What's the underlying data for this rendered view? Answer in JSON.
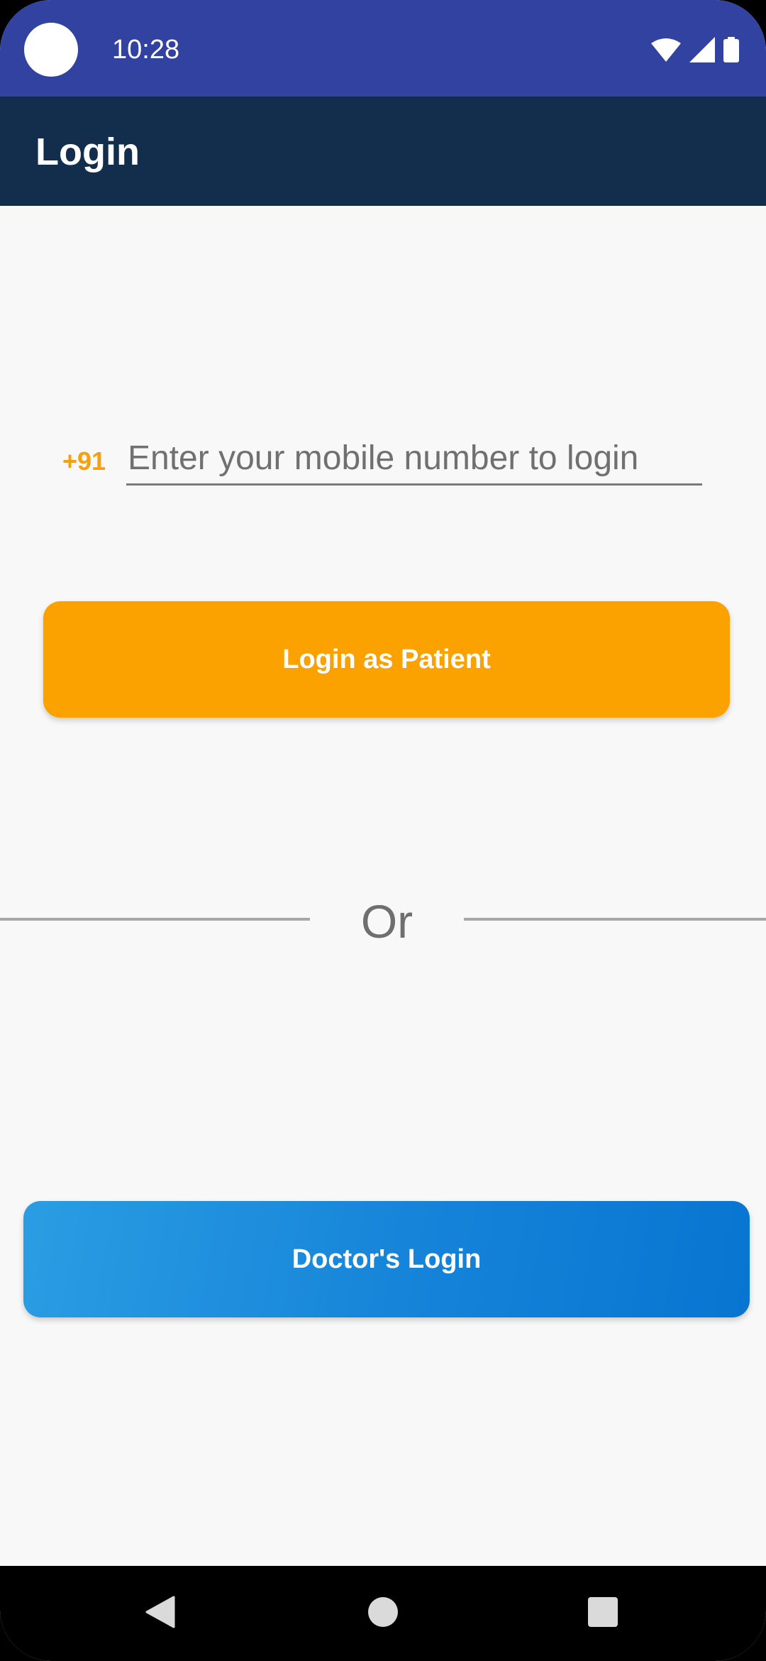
{
  "status_bar": {
    "time": "10:28",
    "icons": [
      "wifi-icon",
      "signal-icon",
      "battery-icon"
    ],
    "background": "#3242A1"
  },
  "app_bar": {
    "title": "Login",
    "background": "#132D4C"
  },
  "login_form": {
    "country_code": "+91",
    "phone_placeholder": "Enter your mobile number to login",
    "phone_value": "",
    "patient_button_label": "Login as Patient",
    "accent_color": "#FBA100"
  },
  "divider": {
    "text": "Or"
  },
  "doctor": {
    "button_label": "Doctor's Login",
    "color": "#0876D1"
  },
  "nav_bar": {
    "icons": [
      "back-icon",
      "home-icon",
      "recents-icon"
    ]
  }
}
